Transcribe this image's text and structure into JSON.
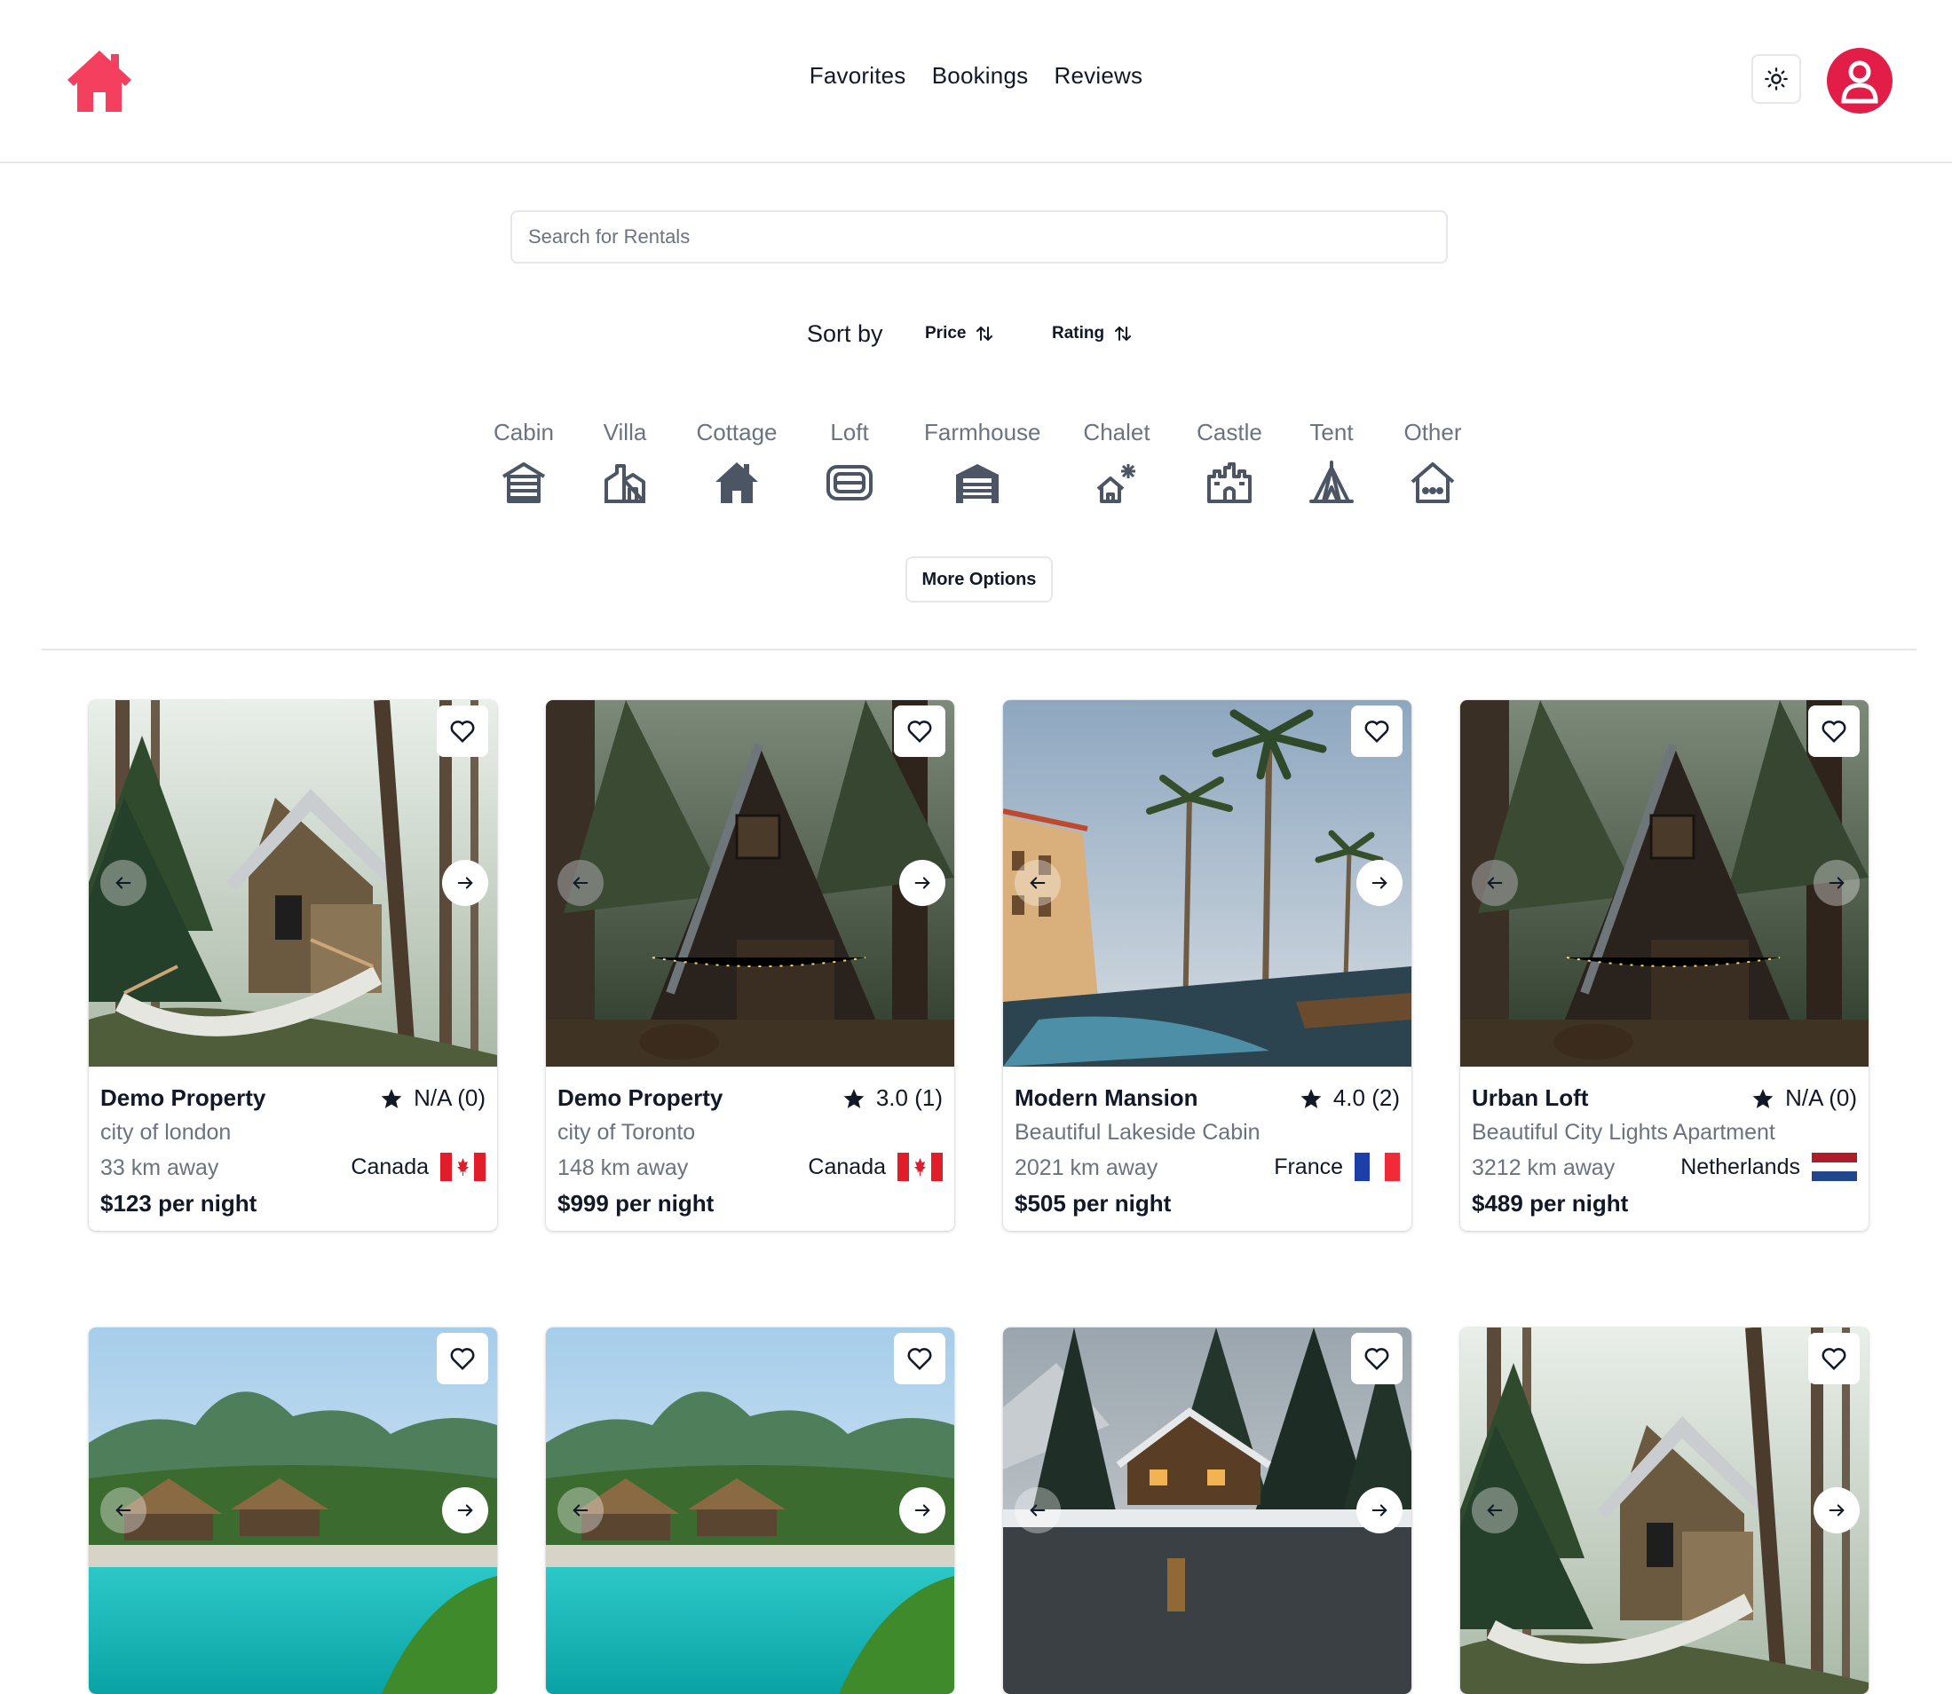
{
  "nav": {
    "favorites": "Favorites",
    "bookings": "Bookings",
    "reviews": "Reviews"
  },
  "search": {
    "placeholder": "Search for Rentals",
    "value": ""
  },
  "sort": {
    "label": "Sort by",
    "price": "Price",
    "rating": "Rating"
  },
  "categories": [
    {
      "label": "Cabin",
      "icon": "cabin-icon"
    },
    {
      "label": "Villa",
      "icon": "villa-icon"
    },
    {
      "label": "Cottage",
      "icon": "cottage-icon"
    },
    {
      "label": "Loft",
      "icon": "loft-icon"
    },
    {
      "label": "Farmhouse",
      "icon": "farmhouse-icon"
    },
    {
      "label": "Chalet",
      "icon": "chalet-icon"
    },
    {
      "label": "Castle",
      "icon": "castle-icon"
    },
    {
      "label": "Tent",
      "icon": "tent-icon"
    },
    {
      "label": "Other",
      "icon": "other-icon"
    }
  ],
  "more_options": "More Options",
  "colors": {
    "brand": "#f43f5e",
    "avatar": "#e11d48",
    "muted_text": "#6b7280"
  },
  "listings": [
    {
      "title": "Demo Property",
      "rating": "N/A (0)",
      "subtitle": "city of london",
      "distance": "33 km away",
      "country": "Canada",
      "flag": "canada-flag",
      "price": "$123 per night",
      "image": "forest cabin with hammock"
    },
    {
      "title": "Demo Property",
      "rating": "3.0 (1)",
      "subtitle": "city of Toronto",
      "distance": "148 km away",
      "country": "Canada",
      "flag": "canada-flag",
      "price": "$999 per night",
      "image": "a-frame cabin in forest"
    },
    {
      "title": "Modern Mansion",
      "rating": "4.0 (2)",
      "subtitle": "Beautiful Lakeside Cabin",
      "distance": "2021 km away",
      "country": "France",
      "flag": "france-flag",
      "price": "$505 per night",
      "image": "resort with palm trees and pool"
    },
    {
      "title": "Urban Loft",
      "rating": "N/A (0)",
      "subtitle": "Beautiful City Lights Apartment",
      "distance": "3212 km away",
      "country": "Netherlands",
      "flag": "netherlands-flag",
      "price": "$489 per night",
      "image": "a-frame cabin in forest"
    },
    {
      "image": "tropical resort pool with huts"
    },
    {
      "image": "tropical resort pool with huts"
    },
    {
      "image": "snowy lodge by lake"
    },
    {
      "image": "forest cabin with hammock"
    }
  ]
}
